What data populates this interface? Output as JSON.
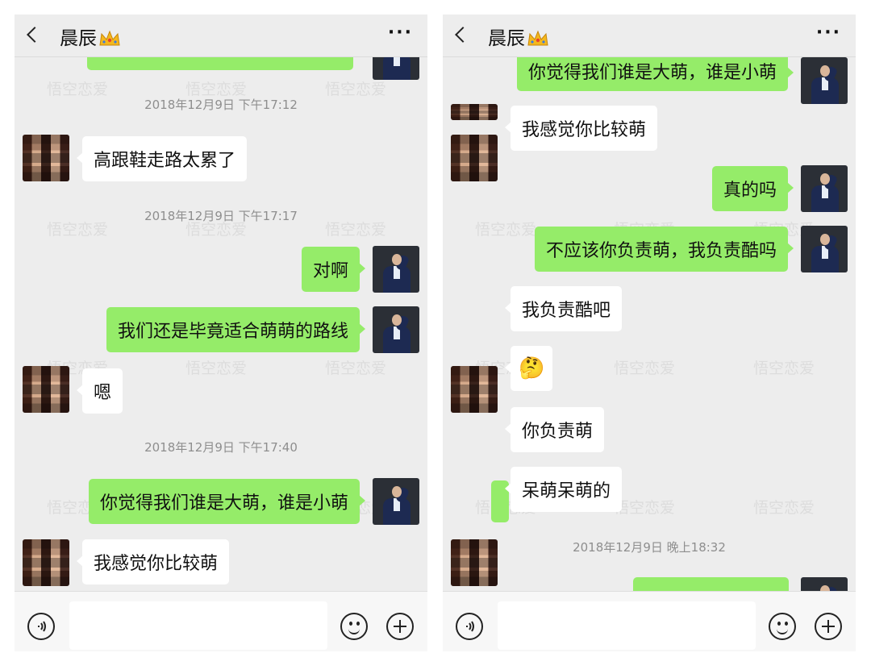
{
  "left": {
    "contact_name": "晨辰",
    "timestamps": [
      "2018年12月9日 下午17:12",
      "2018年12月9日 下午17:17",
      "2018年12月9日 下午17:40"
    ],
    "messages": [
      {
        "from": "contact",
        "text": "高跟鞋走路太累了"
      },
      {
        "from": "me",
        "text": "对啊"
      },
      {
        "from": "me",
        "text": "我们还是毕竟适合萌萌的路线"
      },
      {
        "from": "contact",
        "text": "嗯"
      },
      {
        "from": "me",
        "text": "你觉得我们谁是大萌，谁是小萌"
      },
      {
        "from": "contact",
        "text": "我感觉你比较萌"
      }
    ]
  },
  "right": {
    "contact_name": "晨辰",
    "timestamps": [
      "2018年12月9日 晚上18:32"
    ],
    "messages": [
      {
        "from": "me",
        "text": "你觉得我们谁是大萌，谁是小萌"
      },
      {
        "from": "contact",
        "text": "我感觉你比较萌"
      },
      {
        "from": "me",
        "text": "真的吗"
      },
      {
        "from": "me",
        "text": "不应该你负责萌，我负责酷吗"
      },
      {
        "from": "contact",
        "text": "我负责酷吧"
      },
      {
        "from": "contact",
        "text": "🤔",
        "type": "sticker"
      },
      {
        "from": "contact",
        "text": "你负责萌"
      },
      {
        "from": "contact",
        "text": "呆萌呆萌的"
      }
    ]
  },
  "watermark": "悟空恋爱",
  "icons": {
    "back": "back-arrow-icon",
    "title_badge": "crown-icon",
    "more": "more-icon",
    "voice": "voice-icon",
    "emoji": "emoji-icon",
    "plus": "plus-icon"
  },
  "colors": {
    "outgoing_bubble": "#95ec69",
    "incoming_bubble": "#ffffff",
    "chat_background": "#ededed"
  }
}
